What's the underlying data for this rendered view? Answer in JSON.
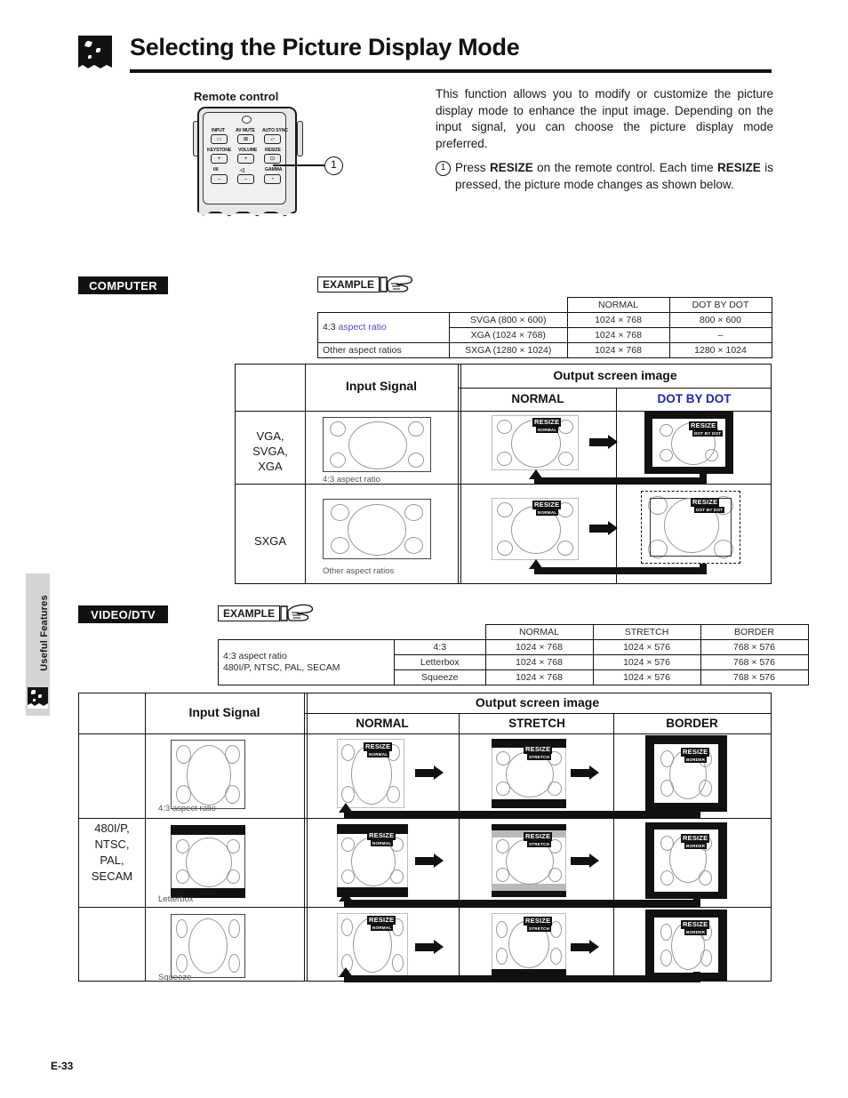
{
  "page": {
    "title": "Selecting the Picture Display Mode",
    "footer": "E-33",
    "side_tab": "Useful Features",
    "title_icon": "sparkle-icon"
  },
  "intro": {
    "remote_caption": "Remote control",
    "body": "This function allows you to modify or customize the picture display mode to enhance the input image. Depending on the input signal, you can choose the picture display mode preferred.",
    "step_number": "1",
    "callout_number": "1",
    "step_text_1": "Press ",
    "step_bold_1": "RESIZE",
    "step_text_2": " on the remote control. Each time ",
    "step_bold_2": "RESIZE",
    "step_text_3": " is pressed, the picture mode changes as shown below."
  },
  "remote": {
    "labels": [
      "INPUT",
      "AV MUTE",
      "AUTO SYNC",
      "KEYSTONE",
      "VOLUME",
      "RESIZE",
      "GAMMA"
    ],
    "buttons": [
      "input",
      "av-mute",
      "auto-sync",
      "keystone-plus",
      "volume-plus",
      "resize",
      "keystone-minus",
      "volume-minus",
      "gamma"
    ]
  },
  "sections": {
    "computer": {
      "chip": "COMPUTER",
      "example_label": "EXAMPLE",
      "spec_table": {
        "columns": [
          "",
          "",
          "NORMAL",
          "DOT BY DOT"
        ],
        "rows": [
          {
            "group": "4:3 aspect ratio",
            "signal": "SVGA (800 × 600)",
            "normal": "1024 × 768",
            "extra": "800 × 600"
          },
          {
            "group": "",
            "signal": "XGA (1024 × 768)",
            "normal": "1024 × 768",
            "extra": "–"
          },
          {
            "group": "Other aspect ratios",
            "signal": "SXGA (1280 × 1024)",
            "normal": "1024 × 768",
            "extra": "1280 × 1024"
          }
        ]
      },
      "diagram": {
        "input_header": "Input Signal",
        "output_header": "Output screen image",
        "mode_headers": [
          "NORMAL",
          "DOT BY DOT"
        ],
        "rows": [
          {
            "label": "VGA,\nSVGA,\nXGA",
            "caption": "4:3 aspect ratio"
          },
          {
            "label": "SXGA",
            "caption": "Other aspect ratios"
          }
        ]
      }
    },
    "video": {
      "chip": "VIDEO/DTV",
      "example_label": "EXAMPLE",
      "spec_table": {
        "columns": [
          "",
          "",
          "NORMAL",
          "STRETCH",
          "BORDER"
        ],
        "group_label_line1": "4:3 aspect ratio",
        "group_label_line2": "480I/P, NTSC, PAL, SECAM",
        "rows": [
          {
            "signal": "4:3",
            "normal": "1024 × 768",
            "stretch": "1024 × 576",
            "border": "768 × 576"
          },
          {
            "signal": "Letterbox",
            "normal": "1024 × 768",
            "stretch": "1024 × 576",
            "border": "768 × 576"
          },
          {
            "signal": "Squeeze",
            "normal": "1024 × 768",
            "stretch": "1024 × 576",
            "border": "768 × 576"
          }
        ]
      },
      "diagram": {
        "input_header": "Input Signal",
        "output_header": "Output screen image",
        "mode_headers": [
          "NORMAL",
          "STRETCH",
          "BORDER"
        ],
        "row_label": "480I/P,\nNTSC,\nPAL,\nSECAM",
        "rows": [
          {
            "caption": "4:3 aspect ratio"
          },
          {
            "caption": "Letterbox"
          },
          {
            "caption": "Squeeze"
          }
        ]
      }
    }
  },
  "badges": {
    "resize": "RESIZE",
    "modes": {
      "normal": "NORMAL",
      "dot_by_dot": "DOT BY DOT",
      "stretch": "STRETCH",
      "border": "BORDER"
    }
  },
  "colors": {
    "accent_blue": "#2020c0",
    "spec_accent": "#4a4ad0",
    "ink": "#111111",
    "sidebar_gray": "#d4d4d4"
  }
}
